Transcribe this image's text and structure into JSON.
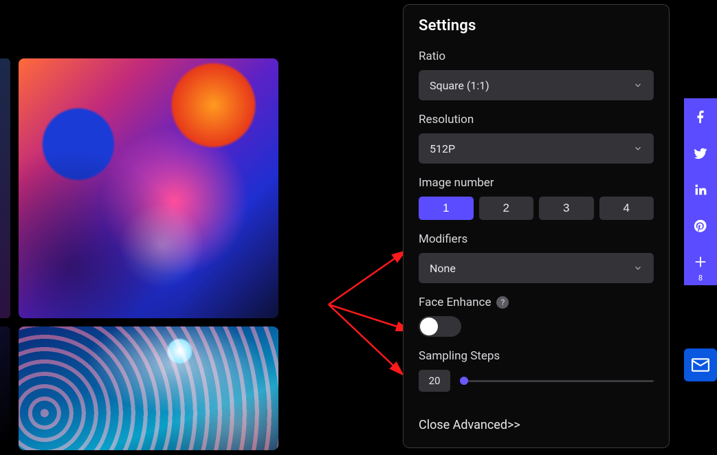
{
  "panel": {
    "title": "Settings",
    "ratio": {
      "label": "Ratio",
      "value": "Square (1:1)"
    },
    "resolution": {
      "label": "Resolution",
      "value": "512P"
    },
    "image_number": {
      "label": "Image number",
      "options": [
        "1",
        "2",
        "3",
        "4"
      ],
      "selected": "1"
    },
    "modifiers": {
      "label": "Modifiers",
      "value": "None"
    },
    "face_enhance": {
      "label": "Face Enhance",
      "on": false,
      "help": "?"
    },
    "sampling_steps": {
      "label": "Sampling Steps",
      "value": "20"
    },
    "close_advanced": "Close Advanced>>"
  },
  "social": {
    "items": [
      {
        "name": "facebook"
      },
      {
        "name": "twitter"
      },
      {
        "name": "linkedin"
      },
      {
        "name": "pinterest"
      },
      {
        "name": "more",
        "count": "8"
      }
    ]
  },
  "colors": {
    "accent": "#5b4cff",
    "panel_bg": "#0a0a0a",
    "control_bg": "#333338",
    "mail": "#0a57e0"
  }
}
